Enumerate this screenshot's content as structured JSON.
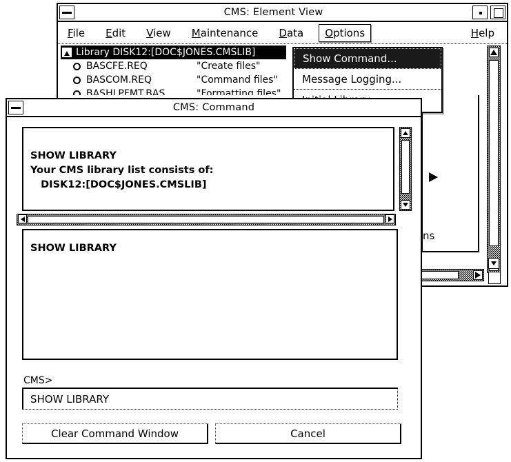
{
  "main_window": {
    "title": "CMS: Element View",
    "window_menu_icon": "window-menu-icon",
    "minimize_icon": "minimize-icon",
    "maximize_icon": "maximize-icon",
    "menubar": [
      {
        "label": "File",
        "mnemonic": "F"
      },
      {
        "label": "Edit",
        "mnemonic": "E"
      },
      {
        "label": "View",
        "mnemonic": "V"
      },
      {
        "label": "Maintenance",
        "mnemonic": "M"
      },
      {
        "label": "Data",
        "mnemonic": "D"
      },
      {
        "label": "Options",
        "mnemonic": "O"
      },
      {
        "label": "Help",
        "mnemonic": "H"
      }
    ],
    "active_menu": "Options",
    "list": {
      "header": "Library DISK12:[DOC$JONES.CMSLIB]",
      "header_icon": "triangle-collapse-icon",
      "rows": [
        {
          "icon": "element-circle-icon",
          "name": "BASCFE.REQ",
          "description": "\"Create files\""
        },
        {
          "icon": "element-circle-icon",
          "name": "BASCOM.REQ",
          "description": "\"Command files\""
        },
        {
          "icon": "element-circle-icon",
          "name": "BASHLPFMT.BAS",
          "description": "\"Formatting files\""
        }
      ]
    },
    "clipped_menu_text": "ns",
    "submenu_indicator_icon": "submenu-arrow-icon"
  },
  "options_menu": {
    "items": [
      {
        "label": "Show Command...",
        "mnemonic": "C",
        "highlighted": true
      },
      {
        "label": "Message Logging...",
        "mnemonic": "L",
        "highlighted": false
      },
      {
        "label": "Initial Library...",
        "mnemonic": "I",
        "highlighted": false
      }
    ]
  },
  "command_dialog": {
    "title": "CMS: Command",
    "window_menu_icon": "window-menu-icon",
    "output_pane": {
      "lines": [
        "SHOW LIBRARY",
        "Your CMS library list consists of:",
        "   DISK12:[DOC$JONES.CMSLIB]"
      ]
    },
    "history_pane": {
      "lines": [
        "SHOW LIBRARY"
      ]
    },
    "prompt_label": "CMS>",
    "command_input": {
      "value": "SHOW LIBRARY",
      "placeholder": ""
    },
    "buttons": [
      {
        "label": "Clear Command Window",
        "name": "clear-command-window-button"
      },
      {
        "label": "Cancel",
        "name": "cancel-button"
      }
    ],
    "scrollbars": {
      "vertical_up_icon": "scroll-up-arrow-icon",
      "vertical_down_icon": "scroll-down-arrow-icon",
      "horizontal_left_icon": "scroll-left-arrow-icon",
      "horizontal_right_icon": "scroll-right-arrow-icon"
    }
  },
  "colors": {
    "window_bg": "#ffffff",
    "border": "#000000",
    "selection_bg": "#000000",
    "selection_fg": "#ffffff",
    "scrollbar_trough": "#b5b5b5"
  }
}
